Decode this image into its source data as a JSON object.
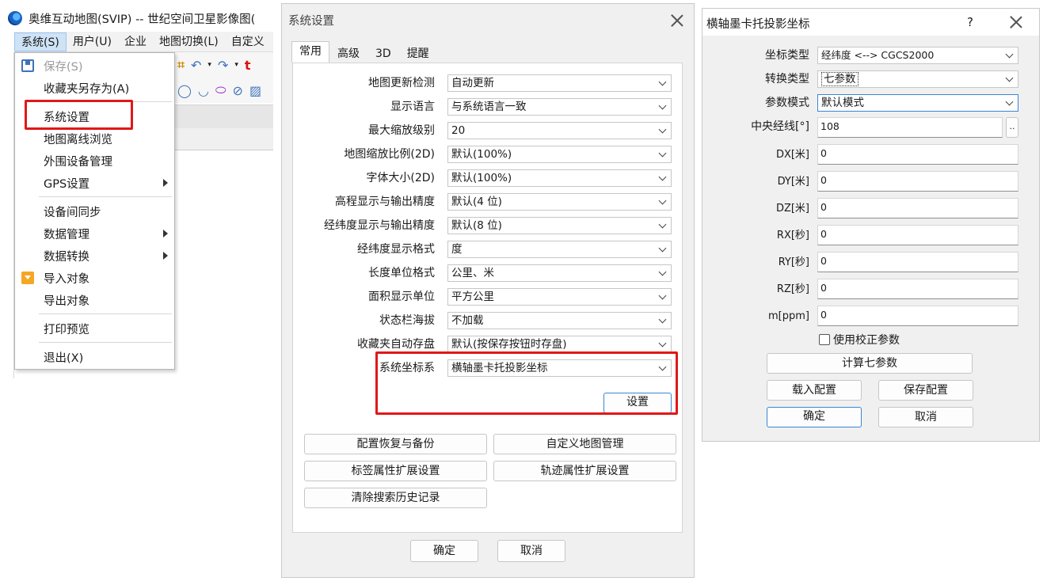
{
  "app": {
    "title": "奥维互动地图(SVIP) -- 世纪空间卫星影像图(",
    "menubar": [
      "系统(S)",
      "用户(U)",
      "企业",
      "地图切换(L)",
      "自定义"
    ],
    "system_menu": [
      {
        "label": "保存(S)",
        "disabled": true,
        "icon": "save-icon"
      },
      {
        "label": "收藏夹另存为(A)"
      },
      {
        "label": "系统设置",
        "highlighted": true
      },
      {
        "label": "地图离线浏览"
      },
      {
        "label": "外围设备管理"
      },
      {
        "label": "GPS设置",
        "submenu": true
      },
      {
        "label": "设备间同步"
      },
      {
        "label": "数据管理",
        "submenu": true
      },
      {
        "label": "数据转换",
        "submenu": true
      },
      {
        "label": "导入对象",
        "icon": "import-folder-icon"
      },
      {
        "label": "导出对象"
      },
      {
        "label": "打印预览"
      },
      {
        "label": "退出(X)"
      }
    ]
  },
  "settings_dialog": {
    "title": "系统设置",
    "tabs": [
      "常用",
      "高级",
      "3D",
      "提醒"
    ],
    "active_tab": "常用",
    "rows": [
      {
        "label": "地图更新检测",
        "value": "自动更新"
      },
      {
        "label": "显示语言",
        "value": "与系统语言一致"
      },
      {
        "label": "最大缩放级别",
        "value": "20"
      },
      {
        "label": "地图缩放比例(2D)",
        "value": "默认(100%)"
      },
      {
        "label": "字体大小(2D)",
        "value": "默认(100%)"
      },
      {
        "label": "高程显示与输出精度",
        "value": "默认(4 位)"
      },
      {
        "label": "经纬度显示与输出精度",
        "value": "默认(8 位)"
      },
      {
        "label": "经纬度显示格式",
        "value": "度"
      },
      {
        "label": "长度单位格式",
        "value": "公里、米"
      },
      {
        "label": "面积显示单位",
        "value": "平方公里"
      },
      {
        "label": "状态栏海拔",
        "value": "不加载"
      },
      {
        "label": "收藏夹自动存盘",
        "value": "默认(按保存按钮时存盘)"
      },
      {
        "label": "系统坐标系",
        "value": "横轴墨卡托投影坐标"
      }
    ],
    "setup_button": "设置",
    "action_buttons": [
      "配置恢复与备份",
      "自定义地图管理",
      "标签属性扩展设置",
      "轨迹属性扩展设置",
      "清除搜索历史记录"
    ],
    "ok": "确定",
    "cancel": "取消"
  },
  "projection_dialog": {
    "title": "横轴墨卡托投影坐标",
    "help": "?",
    "coord_type_label": "坐标类型",
    "coord_type_value": "经纬度 <--> CGCS2000",
    "transform_label": "转换类型",
    "transform_value": "七参数",
    "param_mode_label": "参数模式",
    "param_mode_value": "默认模式",
    "central_meridian_label": "中央经线[°]",
    "central_meridian_value": "108",
    "browse_label": "..",
    "params": [
      {
        "label": "DX[米]",
        "value": "0"
      },
      {
        "label": "DY[米]",
        "value": "0"
      },
      {
        "label": "DZ[米]",
        "value": "0"
      },
      {
        "label": "RX[秒]",
        "value": "0"
      },
      {
        "label": "RY[秒]",
        "value": "0"
      },
      {
        "label": "RZ[秒]",
        "value": "0"
      },
      {
        "label": "m[ppm]",
        "value": "0"
      }
    ],
    "use_correction_label": "使用校正参数",
    "use_correction_checked": false,
    "calc_button": "计算七参数",
    "load_button": "载入配置",
    "save_button": "保存配置",
    "ok": "确定",
    "cancel": "取消"
  },
  "colors": {
    "highlight_red": "#e01818",
    "focus_blue": "#3a86d6"
  }
}
